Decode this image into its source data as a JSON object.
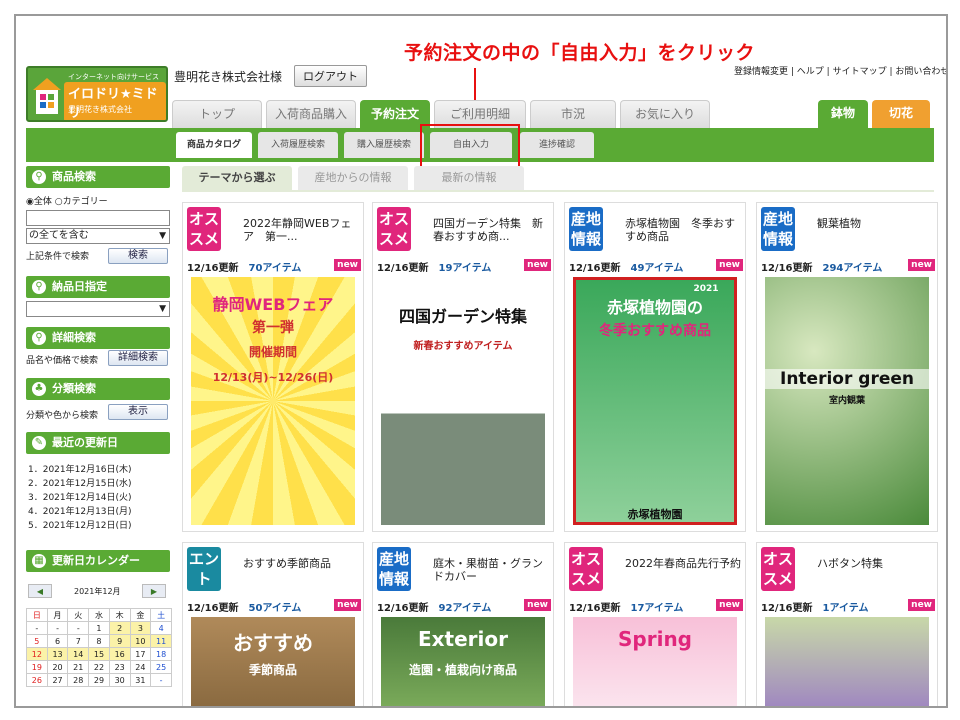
{
  "annotation": {
    "text": "予約注文の中の「自由入力」をクリック",
    "color": "#e81010"
  },
  "logo": {
    "line1": "インターネット向けサービス",
    "line2": "イロドリ★ミドリ",
    "line3": "豊明花き株式会社"
  },
  "header": {
    "company": "豊明花き株式会社様",
    "logout": "ログアウト"
  },
  "top_links": [
    "登録情報変更",
    "ヘルプ",
    "サイトマップ",
    "お問い合わせ"
  ],
  "main_tabs": [
    "トップ",
    "入荷商品購入",
    "予約注文",
    "ご利用明細",
    "市況",
    "お気に入り"
  ],
  "right_tabs": [
    "鉢物",
    "切花"
  ],
  "sub_tabs": [
    "商品カタログ",
    "入荷履歴検索",
    "購入履歴検索",
    "自由入力",
    "進捗確認"
  ],
  "content_tabs": [
    "テーマから選ぶ",
    "産地からの情報",
    "最新の情報"
  ],
  "sidebar": {
    "product_search": "商品検索",
    "radio_all": "全体",
    "radio_category": "カテゴリー",
    "contains_all": "の全てを含む",
    "search_note": "上記条件で検索",
    "search_btn": "検索",
    "delivery_date": "納品日指定",
    "detail_search": "詳細検索",
    "detail_note": "品名や価格で検索",
    "detail_btn": "詳細検索",
    "class_search": "分類検索",
    "class_note": "分類や色から検索",
    "class_btn": "表示",
    "recent_updates": "最近の更新日",
    "updates": [
      "1．2021年12月16日(木)",
      "2．2021年12月15日(水)",
      "3．2021年12月14日(火)",
      "4．2021年12月13日(月)",
      "5．2021年12月12日(日)"
    ],
    "calendar_title": "更新日カレンダー",
    "cal_month": "2021年12月",
    "cal_prev": "◀",
    "cal_next": "▶"
  },
  "calendar": {
    "headers": [
      "日",
      "月",
      "火",
      "水",
      "木",
      "金",
      "土"
    ],
    "rows": [
      [
        "-",
        "-",
        "-",
        "1",
        "2",
        "3",
        "4"
      ],
      [
        "5",
        "6",
        "7",
        "8",
        "9",
        "10",
        "11"
      ],
      [
        "12",
        "13",
        "14",
        "15",
        "16",
        "17",
        "18"
      ],
      [
        "19",
        "20",
        "21",
        "22",
        "23",
        "24",
        "25"
      ],
      [
        "26",
        "27",
        "28",
        "29",
        "30",
        "31",
        "-"
      ]
    ]
  },
  "cards": [
    {
      "badge": "オス\nスメ",
      "badge_color": "#e0267c",
      "title": "2022年静岡WEBフェア　第一...",
      "date": "12/16更新",
      "count": "70アイテム",
      "new": "new",
      "img_text": [
        "静岡WEBフェア",
        "第一弾",
        "開催期間",
        "12/13(月)~12/26(日)"
      ]
    },
    {
      "badge": "オス\nスメ",
      "badge_color": "#e0267c",
      "title": "四国ガーデン特集　新春おすすめ商...",
      "date": "12/16更新",
      "count": "19アイテム",
      "new": "new",
      "img_text": [
        "四国ガーデン特集",
        "新春おすすめアイテム"
      ]
    },
    {
      "badge": "産地\n情報",
      "badge_color": "#1a6cc6",
      "title": "赤塚植物園　冬季おすすめ商品",
      "date": "12/16更新",
      "count": "49アイテム",
      "new": "new",
      "img_text": [
        "赤塚植物園の",
        "冬季おすすめ商品",
        "2021",
        "赤塚植物園"
      ]
    },
    {
      "badge": "産地\n情報",
      "badge_color": "#1a6cc6",
      "title": "観葉植物",
      "date": "12/16更新",
      "count": "294アイテム",
      "new": "new",
      "img_text": [
        "Interior green",
        "室内観葉"
      ]
    },
    {
      "badge": "エント\nランス",
      "badge_color": "#1a8aa0",
      "title": "おすすめ季節商品",
      "date": "12/16更新",
      "count": "50アイテム",
      "new": "new",
      "img_text": [
        "おすすめ",
        "季節商品"
      ]
    },
    {
      "badge": "産地\n情報",
      "badge_color": "#1a6cc6",
      "title": "庭木・果樹苗・グランドカバー",
      "date": "12/16更新",
      "count": "92アイテム",
      "new": "new",
      "img_text": [
        "Exterior",
        "造園・植栽向け商品"
      ]
    },
    {
      "badge": "オス\nスメ",
      "badge_color": "#e0267c",
      "title": "2022年春商品先行予約",
      "date": "12/16更新",
      "count": "17アイテム",
      "new": "new",
      "img_text": [
        "Spring"
      ]
    },
    {
      "badge": "オス\nスメ",
      "badge_color": "#e0267c",
      "title": "ハボタン特集",
      "date": "12/16更新",
      "count": "1アイテム",
      "new": "new",
      "img_text": []
    }
  ]
}
